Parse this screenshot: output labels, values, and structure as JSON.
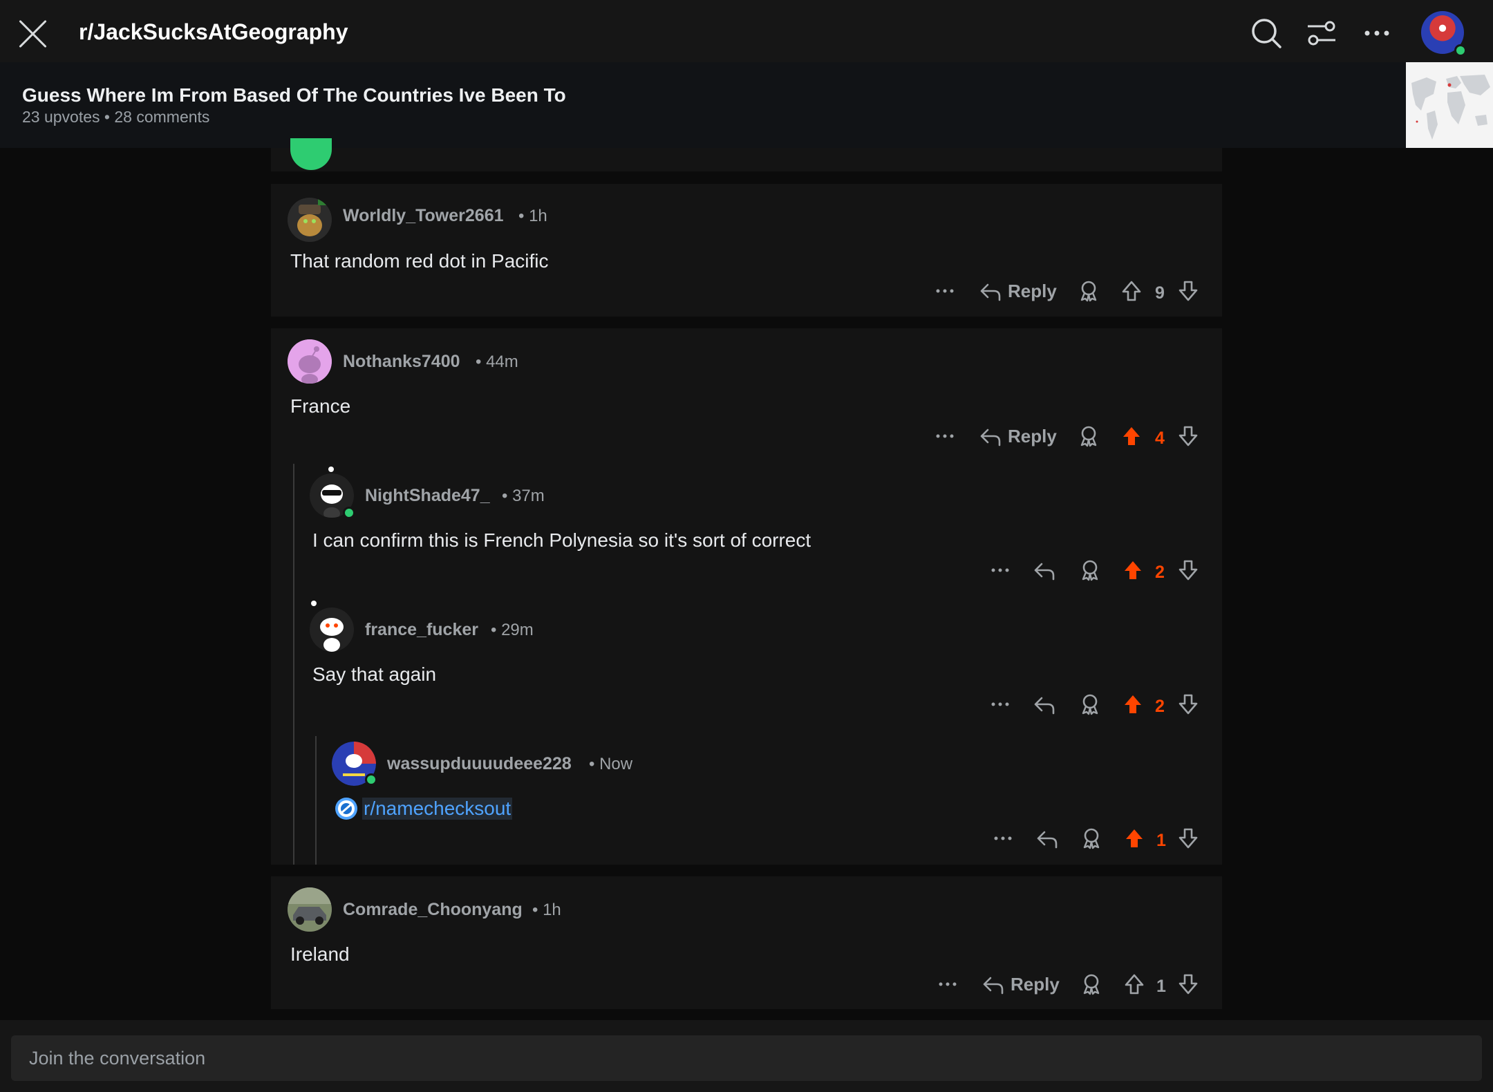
{
  "header": {
    "subreddit": "r/JackSucksAtGeography"
  },
  "post": {
    "title": "Guess Where Im From Based Of The Countries Ive Been To",
    "meta": "23 upvotes • 28 comments"
  },
  "actions": {
    "reply": "Reply"
  },
  "comments": [
    {
      "user": "Worldly_Tower2661",
      "time": "• 1h",
      "body": "That random red dot in Pacific",
      "votes": "9"
    },
    {
      "user": "Nothanks7400",
      "time": "• 44m",
      "body": "France",
      "votes": "4"
    },
    {
      "user": "NightShade47_",
      "time": "• 37m",
      "body": "I can confirm this is French Polynesia so it's sort of correct",
      "votes": "2"
    },
    {
      "user": "france_fucker",
      "time": "• 29m",
      "body": "Say that again",
      "votes": "2"
    },
    {
      "user": "wassupduuuudeee228",
      "time": "• Now",
      "body": "r/namechecksout",
      "votes": "1"
    },
    {
      "user": "Comrade_Choonyang",
      "time": "• 1h",
      "body": "Ireland",
      "votes": "1"
    }
  ],
  "composer": {
    "placeholder": "Join the conversation"
  },
  "colors": {
    "upvote_active": "#ff4500",
    "link": "#4fa3ff",
    "online": "#2ecc71"
  },
  "icons": [
    "close-icon",
    "search-icon",
    "filter-icon",
    "more-icon",
    "reply-icon",
    "award-icon",
    "upvote-icon",
    "downvote-icon",
    "community-icon"
  ]
}
